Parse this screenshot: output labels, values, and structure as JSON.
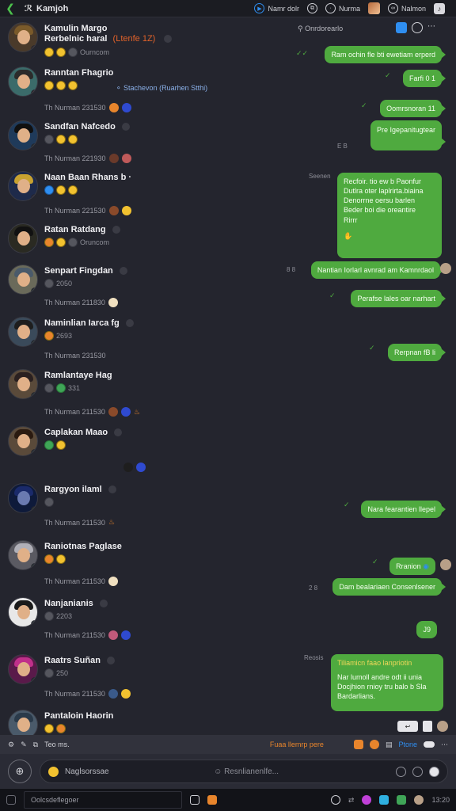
{
  "header": {
    "title": "Kamjoh",
    "items": [
      {
        "label": "Namr dolr",
        "icon": "circle-play-icon"
      },
      {
        "label": "",
        "icon": "copy-icon"
      },
      {
        "label": "Nurma",
        "icon": "chat-icon"
      },
      {
        "label": "Nalmon",
        "icon": "link-icon"
      }
    ]
  },
  "contacts": [
    {
      "name": "Kamulin Margo",
      "sub": "Rerbelnic haral",
      "tag": "(Ltenfe 1Z)",
      "status": "Ourncom",
      "time": "",
      "avatar": {
        "hair": "#7a5a2a",
        "bg": "#4a3a2a",
        "badge": "#e8852c"
      }
    },
    {
      "name": "Ranntan Fhagrio",
      "sub": "",
      "tag": "",
      "status": "",
      "time": "Th Nurman 231530",
      "avatar": {
        "hair": "#2b2b2b",
        "bg": "#3b6b6a",
        "badge": "#e04a3a"
      }
    },
    {
      "name": "Sandfan Nafcedo",
      "sub": "",
      "tag": "",
      "status": "",
      "time": "Th Nurman 221930",
      "avatar": {
        "hair": "#101010",
        "bg": "#1f3a5a",
        "badge": "#3fa557"
      }
    },
    {
      "name": "Naan Baan Rhans b ·",
      "sub": "",
      "tag": "",
      "status": "",
      "time": "Th Nurman 221530",
      "avatar": {
        "hair": "#c8a230",
        "bg": "#1e2a4a",
        "badge": "#8a6ad8"
      }
    },
    {
      "name": "Ratan Ratdang",
      "sub": "",
      "tag": "",
      "status": "Oruncom",
      "time": "",
      "avatar": {
        "hair": "#111111",
        "bg": "#2a2a22",
        "badge": "#3fa557"
      }
    },
    {
      "name": "Senpart Fingdan",
      "sub": "",
      "tag": "",
      "status": "",
      "time": "Th Nurman 211830",
      "count": "2050",
      "avatar": {
        "hair": "#4a5a6a",
        "bg": "#6a6a5a",
        "badge": "#3fa557"
      }
    },
    {
      "name": "Naminlian Iarca fg",
      "sub": "",
      "tag": "",
      "status": "",
      "time": "Th Nurman 231530",
      "count": "2693",
      "avatar": {
        "hair": "#1e1e1e",
        "bg": "#3a4a5a",
        "badge": "#3fa557"
      }
    },
    {
      "name": "Ramlantaye Hag",
      "sub": "",
      "tag": "",
      "status": "",
      "time": "Th Nurman 211530",
      "count": "331",
      "avatar": {
        "hair": "#2a2020",
        "bg": "#5a4a3a",
        "badge": "#3fa557"
      }
    },
    {
      "name": "Caplakan Maao",
      "sub": "",
      "tag": "",
      "status": "",
      "time": "",
      "avatar": {
        "hair": "#2a1a10",
        "bg": "#5a4a3a",
        "badge": "#3fa557"
      }
    },
    {
      "name": "Rargyon ilaml",
      "sub": "",
      "tag": "",
      "status": "",
      "time": "Th Nurman 211530",
      "avatar": {
        "hair": "#1a2a6a",
        "bg": "#0e1a3a",
        "badge": "#3fa557"
      }
    },
    {
      "name": "Raniotnas Paglase",
      "sub": "",
      "tag": "",
      "status": "",
      "time": "Th Nurman 211530",
      "avatar": {
        "hair": "#b0b0b8",
        "bg": "#5a5a62",
        "badge": "#3fa557"
      }
    },
    {
      "name": "Nanjanianis",
      "sub": "",
      "tag": "",
      "status": "",
      "time": "Th Nurman 211530",
      "count": "2203",
      "avatar": {
        "hair": "#1a1a1a",
        "bg": "#e8e8e8",
        "badge": "#3fa557"
      }
    },
    {
      "name": "Raatrs Suñan",
      "sub": "",
      "tag": "",
      "status": "",
      "time": "Th Nurman 211530",
      "count": "250",
      "avatar": {
        "hair": "#c0308a",
        "bg": "#5a1a4a",
        "badge": "#3fa557"
      }
    },
    {
      "name": "Pantaloin Haorin",
      "sub": "",
      "tag": "",
      "status": "",
      "time": "",
      "avatar": {
        "hair": "#2a3a4a",
        "bg": "#4a5a6a",
        "badge": "#3fa557"
      }
    }
  ],
  "thread": {
    "search_label": "Onrdorearlo",
    "bubbles": [
      {
        "lines": [
          "Ram ochin fle bti ewetiam erperd"
        ],
        "meta": ""
      },
      {
        "lines": [
          "Farfi 0 1"
        ],
        "meta": ""
      },
      {
        "lines": [
          "Oomrsnoran 11"
        ],
        "meta": ""
      },
      {
        "lines": [
          "Pre Igepanitugtear"
        ],
        "meta": "E B"
      },
      {
        "lines": [
          "Recfoir. tio ew b Paonfur",
          "Dutlra oter laplrirta.biaina",
          "Denorrne oersu barlen",
          "Beder boi die oreantire",
          "Rirrr"
        ],
        "meta": "Seenen"
      },
      {
        "lines": [
          "Nantian Iorlarl avnrad am Kamnrdaol"
        ],
        "meta": "8 8"
      },
      {
        "lines": [
          "Perafse lales oar narhart"
        ],
        "meta": ""
      },
      {
        "lines": [
          "Rerpnan fB li"
        ],
        "meta": ""
      },
      {
        "lines": [
          "Nara fearantien llepel"
        ],
        "meta": ""
      },
      {
        "lines": [
          "Rranion"
        ],
        "meta": ""
      },
      {
        "lines": [
          "Dam bealariaen Consenlsener"
        ],
        "meta": "2 8"
      },
      {
        "lines": [
          "J9"
        ],
        "meta": ""
      },
      {
        "lines": [
          "Tiliamicn faao lanpriotin",
          "Nar lumoll andre odt ii unia",
          "Docjhion rnioy tru balo b Sla",
          "Bardarlians."
        ],
        "meta": "Reosis"
      }
    ]
  },
  "message_bar": {
    "left_label": "Teo ms.",
    "center_label": "Fuaa llemrp pere",
    "blue_label": "Ptone"
  },
  "composer": {
    "placeholder": "Naglsorssae",
    "secondary": "Resnlianenlfe..."
  },
  "taskbar": {
    "search_placeholder": "Oolcsdeflegoer",
    "clock": "13:20"
  },
  "colors": {
    "accent_green": "#4faa3f",
    "background": "#24252e",
    "highlight_orange": "#e8852c",
    "link_blue": "#2f8ef0"
  }
}
